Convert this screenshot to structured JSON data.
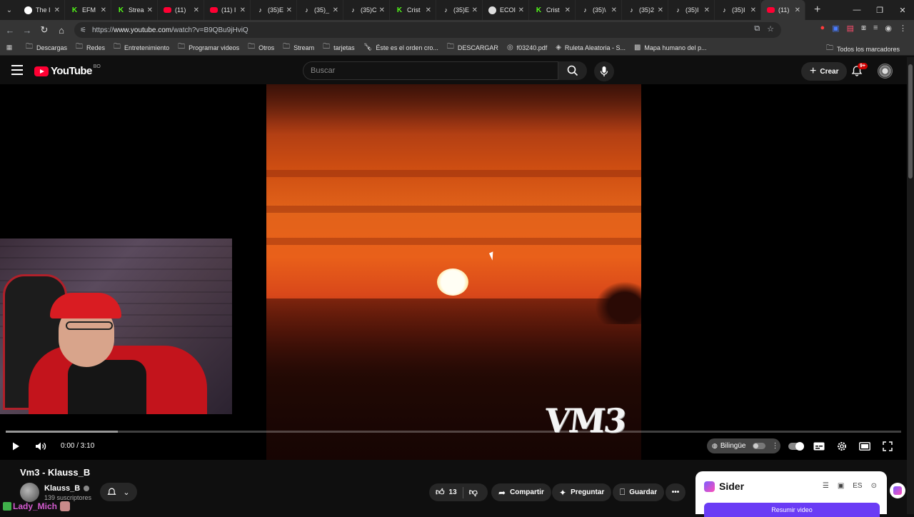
{
  "browser": {
    "tabs": [
      {
        "label": "The I",
        "favicon": "threads-icon"
      },
      {
        "label": "EFM",
        "favicon": "kick-icon"
      },
      {
        "label": "Strea",
        "favicon": "kick-icon"
      },
      {
        "label": "(11)",
        "favicon": "youtube-icon"
      },
      {
        "label": "(11) I",
        "favicon": "youtube-icon"
      },
      {
        "label": "(35)E",
        "favicon": "tiktok-icon"
      },
      {
        "label": "(35)_",
        "favicon": "tiktok-icon"
      },
      {
        "label": "(35)C",
        "favicon": "tiktok-icon"
      },
      {
        "label": "Crist",
        "favicon": "kick-icon"
      },
      {
        "label": "(35)E",
        "favicon": "tiktok-icon"
      },
      {
        "label": "ECOI",
        "favicon": "chrome-icon"
      },
      {
        "label": "Crist",
        "favicon": "kick-icon"
      },
      {
        "label": "(35)\\",
        "favicon": "tiktok-icon"
      },
      {
        "label": "(35)2",
        "favicon": "tiktok-icon"
      },
      {
        "label": "(35)I",
        "favicon": "tiktok-icon"
      },
      {
        "label": "(35)I",
        "favicon": "tiktok-icon"
      },
      {
        "label": "(11)",
        "favicon": "youtube-icon",
        "active": true
      }
    ],
    "url": {
      "prefix": "https://",
      "host": "www.youtube.com",
      "path": "/watch?v=B9QBu9jHviQ"
    },
    "bookmarks": [
      {
        "label": "Descargas",
        "icon": "folder-icon"
      },
      {
        "label": "Redes",
        "icon": "folder-icon"
      },
      {
        "label": "Entretenimiento",
        "icon": "folder-icon"
      },
      {
        "label": "Programar videos",
        "icon": "folder-icon"
      },
      {
        "label": "Otros",
        "icon": "folder-icon"
      },
      {
        "label": "Stream",
        "icon": "folder-icon"
      },
      {
        "label": "tarjetas",
        "icon": "folder-icon"
      },
      {
        "label": "Éste es el orden cro...",
        "icon": "bottle-icon"
      },
      {
        "label": "DESCARGAR",
        "icon": "folder-icon"
      },
      {
        "label": "f03240.pdf",
        "icon": "globe-icon"
      },
      {
        "label": "Ruleta Aleatoria - S...",
        "icon": "wheel-icon"
      },
      {
        "label": "Mapa humano del p...",
        "icon": "map-icon"
      }
    ],
    "all_bookmarks": "Todos los marcadores"
  },
  "youtube": {
    "logo_text": "YouTube",
    "country_code": "BO",
    "search_placeholder": "Buscar",
    "create_label": "Crear",
    "notifications_badge": "9+"
  },
  "player": {
    "overlay_text": "VM3",
    "time": "0:00 / 3:10",
    "progress_loaded_fraction": 0.125,
    "bilingual_label": "Bilingüe"
  },
  "video": {
    "title": "Vm3 - Klauss_B",
    "channel": "Klauss_B",
    "subscribers": "139 suscriptores",
    "likes": "13",
    "share_label": "Compartir",
    "ask_label": "Preguntar",
    "save_label": "Guardar"
  },
  "chat_overlay": {
    "username": "Lady_Mich"
  },
  "sider": {
    "name": "Sider",
    "language": "ES",
    "summarize_label": "Resumir video"
  },
  "colors": {
    "accent_red": "#ff0033",
    "sider_purple": "#6a3cf5",
    "kick_green": "#53fc18"
  }
}
